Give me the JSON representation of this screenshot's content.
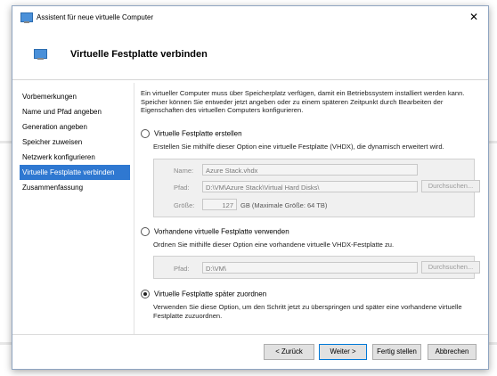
{
  "window": {
    "title": "Assistent für neue virtuelle Computer",
    "close_glyph": "✕"
  },
  "header": {
    "title": "Virtuelle Festplatte verbinden"
  },
  "nav": {
    "items": [
      {
        "label": "Vorbemerkungen"
      },
      {
        "label": "Name und Pfad angeben"
      },
      {
        "label": "Generation angeben"
      },
      {
        "label": "Speicher zuweisen"
      },
      {
        "label": "Netzwerk konfigurieren"
      },
      {
        "label": "Virtuelle Festplatte verbinden"
      },
      {
        "label": "Zusammenfassung"
      }
    ],
    "active_index": 5
  },
  "content": {
    "intro": "Ein virtueller Computer muss über Speicherplatz verfügen, damit ein Betriebssystem installiert werden kann. Speicher können Sie entweder jetzt angeben oder zu einem späteren Zeitpunkt durch Bearbeiten der Eigenschaften des virtuellen Computers konfigurieren.",
    "option_create": {
      "label": "Virtuelle Festplatte erstellen",
      "description": "Erstellen Sie mithilfe dieser Option eine virtuelle Festplatte (VHDX), die dynamisch erweitert wird.",
      "name_label": "Name:",
      "name_value": "Azure Stack.vhdx",
      "path_label": "Pfad:",
      "path_value": "D:\\VM\\Azure Stack\\Virtual Hard Disks\\",
      "browse_label": "Durchsuchen...",
      "size_label": "Größe:",
      "size_value": "127",
      "size_unit": "GB (Maximale Größe: 64 TB)"
    },
    "option_existing": {
      "label": "Vorhandene virtuelle Festplatte verwenden",
      "description": "Ordnen Sie mithilfe dieser Option eine vorhandene virtuelle VHDX-Festplatte zu.",
      "path_label": "Pfad:",
      "path_value": "D:\\VM\\",
      "browse_label": "Durchsuchen..."
    },
    "option_later": {
      "label": "Virtuelle Festplatte später zuordnen",
      "description": "Verwenden Sie diese Option, um den Schritt jetzt zu überspringen und später eine vorhandene virtuelle Festplatte zuzuordnen."
    },
    "selected_option": "later"
  },
  "footer": {
    "back_label": "< Zurück",
    "next_label": "Weiter >",
    "finish_label": "Fertig stellen",
    "cancel_label": "Abbrechen"
  }
}
